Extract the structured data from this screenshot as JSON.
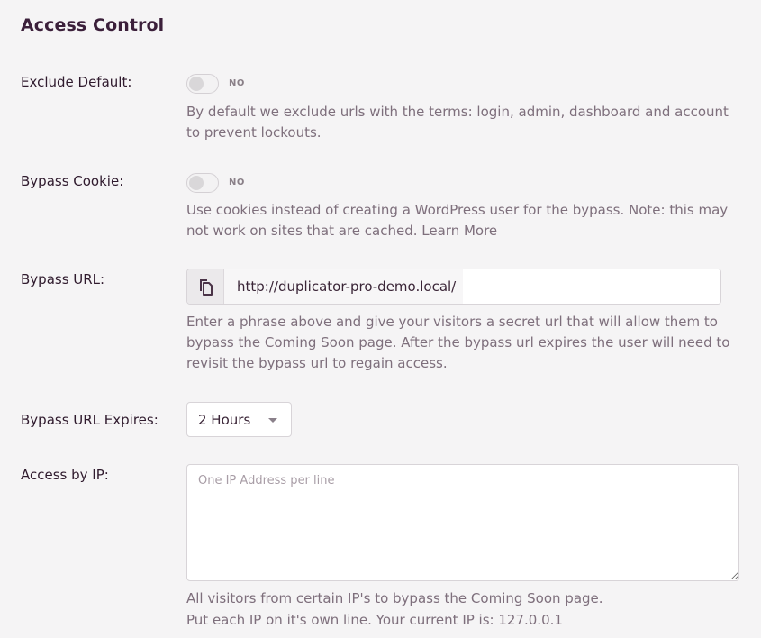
{
  "section": {
    "title": "Access Control"
  },
  "exclude_default": {
    "label": "Exclude Default:",
    "state": "NO",
    "help": "By default we exclude urls with the terms: login, admin, dashboard and account to prevent lockouts."
  },
  "bypass_cookie": {
    "label": "Bypass Cookie:",
    "state": "NO",
    "help": "Use cookies instead of creating a WordPress user for the bypass. Note: this may not work on sites that are cached.",
    "learn_more": "Learn More"
  },
  "bypass_url": {
    "label": "Bypass URL:",
    "prefix": "http://duplicator-pro-demo.local/",
    "value": "",
    "copy_icon": "copy-icon",
    "help": "Enter a phrase above and give your visitors a secret url that will allow them to bypass the Coming Soon page. After the bypass url expires the user will need to revisit the bypass url to regain access."
  },
  "bypass_url_expires": {
    "label": "Bypass URL Expires:",
    "selected": "2 Hours"
  },
  "access_by_ip": {
    "label": "Access by IP:",
    "placeholder": "One IP Address per line",
    "help_line1": "All visitors from certain IP's to bypass the Coming Soon page.",
    "help_line2": "Put each IP on it's own line. Your current IP is: 127.0.0.1"
  }
}
